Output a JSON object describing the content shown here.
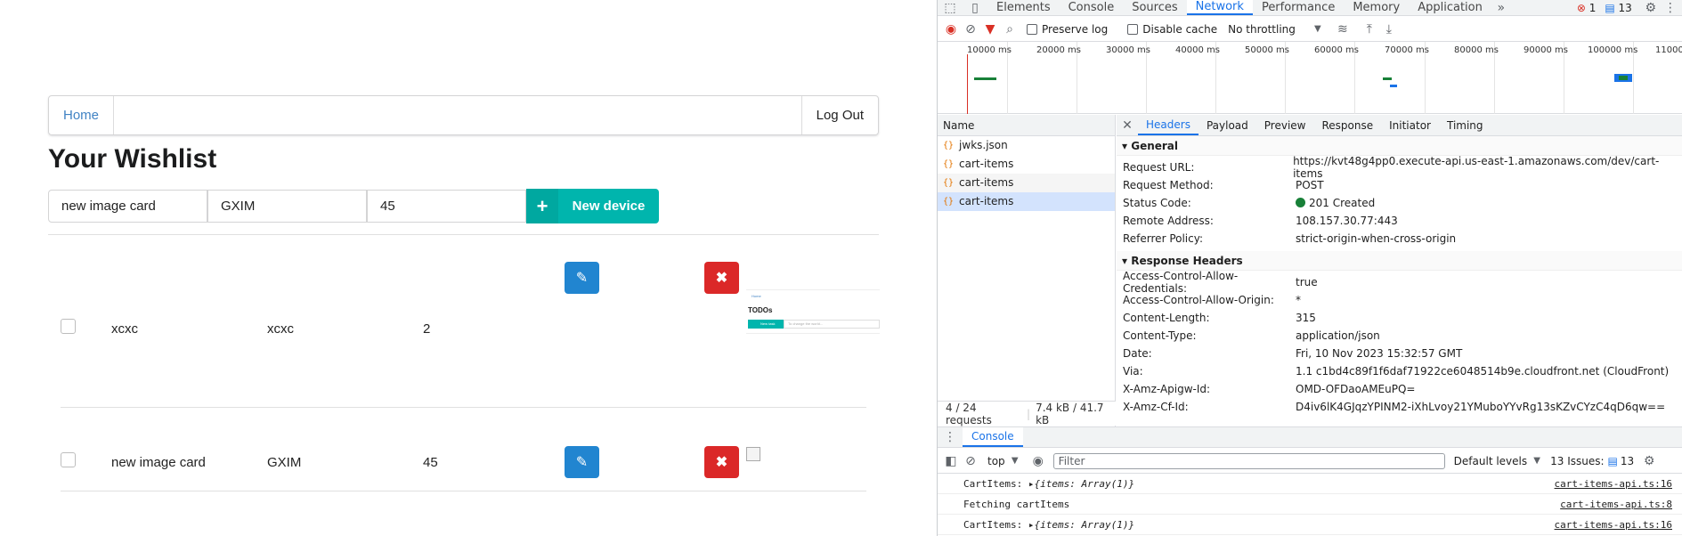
{
  "app": {
    "menu": {
      "home": "Home",
      "logout": "Log Out"
    },
    "title": "Your Wishlist",
    "form": {
      "name": "new image card",
      "brand": "GXIM",
      "price": "45",
      "new_label": "New device"
    },
    "rows": [
      {
        "name": "xcxc",
        "brand": "xcxc",
        "qty": "2",
        "thumb": {
          "nav": "Home",
          "title": "TODOs",
          "btn": "New task",
          "hint": "To change the world..."
        }
      },
      {
        "name": "new image card",
        "brand": "GXIM",
        "qty": "45"
      }
    ]
  },
  "devtools": {
    "tabs": [
      "Elements",
      "Console",
      "Sources",
      "Network",
      "Performance",
      "Memory",
      "Application"
    ],
    "active_tab": "Network",
    "errors": "1",
    "issues": "13",
    "toolbar": {
      "preserve_log": "Preserve log",
      "disable_cache": "Disable cache",
      "throttling": "No throttling"
    },
    "ticks": [
      "10000 ms",
      "20000 ms",
      "30000 ms",
      "40000 ms",
      "50000 ms",
      "60000 ms",
      "70000 ms",
      "80000 ms",
      "90000 ms",
      "100000 ms",
      "11000"
    ],
    "name_header": "Name",
    "requests": [
      "jwks.json",
      "cart-items",
      "cart-items",
      "cart-items"
    ],
    "detail_tabs": [
      "Headers",
      "Payload",
      "Preview",
      "Response",
      "Initiator",
      "Timing"
    ],
    "general_title": "General",
    "general": [
      {
        "k": "Request URL:",
        "v": "https://kvt48g4pp0.execute-api.us-east-1.amazonaws.com/dev/cart-items"
      },
      {
        "k": "Request Method:",
        "v": "POST"
      },
      {
        "k": "Status Code:",
        "v": "201 Created"
      },
      {
        "k": "Remote Address:",
        "v": "108.157.30.77:443"
      },
      {
        "k": "Referrer Policy:",
        "v": "strict-origin-when-cross-origin"
      }
    ],
    "response_title": "Response Headers",
    "response": [
      {
        "k": "Access-Control-Allow-Credentials:",
        "v": "true"
      },
      {
        "k": "Access-Control-Allow-Origin:",
        "v": "*"
      },
      {
        "k": "Content-Length:",
        "v": "315"
      },
      {
        "k": "Content-Type:",
        "v": "application/json"
      },
      {
        "k": "Date:",
        "v": "Fri, 10 Nov 2023 15:32:57 GMT"
      },
      {
        "k": "Via:",
        "v": "1.1 c1bd4c89f1f6daf71922ce6048514b9e.cloudfront.net (CloudFront)"
      },
      {
        "k": "X-Amz-Apigw-Id:",
        "v": "OMD-OFDaoAMEuPQ="
      },
      {
        "k": "X-Amz-Cf-Id:",
        "v": "D4iv6lK4GJqzYPINM2-iXhLvoy21YMuboYYvRg13sKZvCYzC4qD6qw=="
      }
    ],
    "status_bar": {
      "requests": "4 / 24 requests",
      "transferred": "7.4 kB / 41.7 kB"
    },
    "console": {
      "title": "Console",
      "context": "top",
      "filter_placeholder": "Filter",
      "levels": "Default levels",
      "issues_label": "13 Issues:",
      "issues_count": "13",
      "logs": [
        {
          "label": "CartItems:",
          "obj": "{items: Array(1)}",
          "src": "cart-items-api.ts:16"
        },
        {
          "label": "Fetching cartItems",
          "obj": "",
          "src": "cart-items-api.ts:8"
        },
        {
          "label": "CartItems:",
          "obj": "{items: Array(1)}",
          "src": "cart-items-api.ts:16"
        }
      ]
    }
  }
}
